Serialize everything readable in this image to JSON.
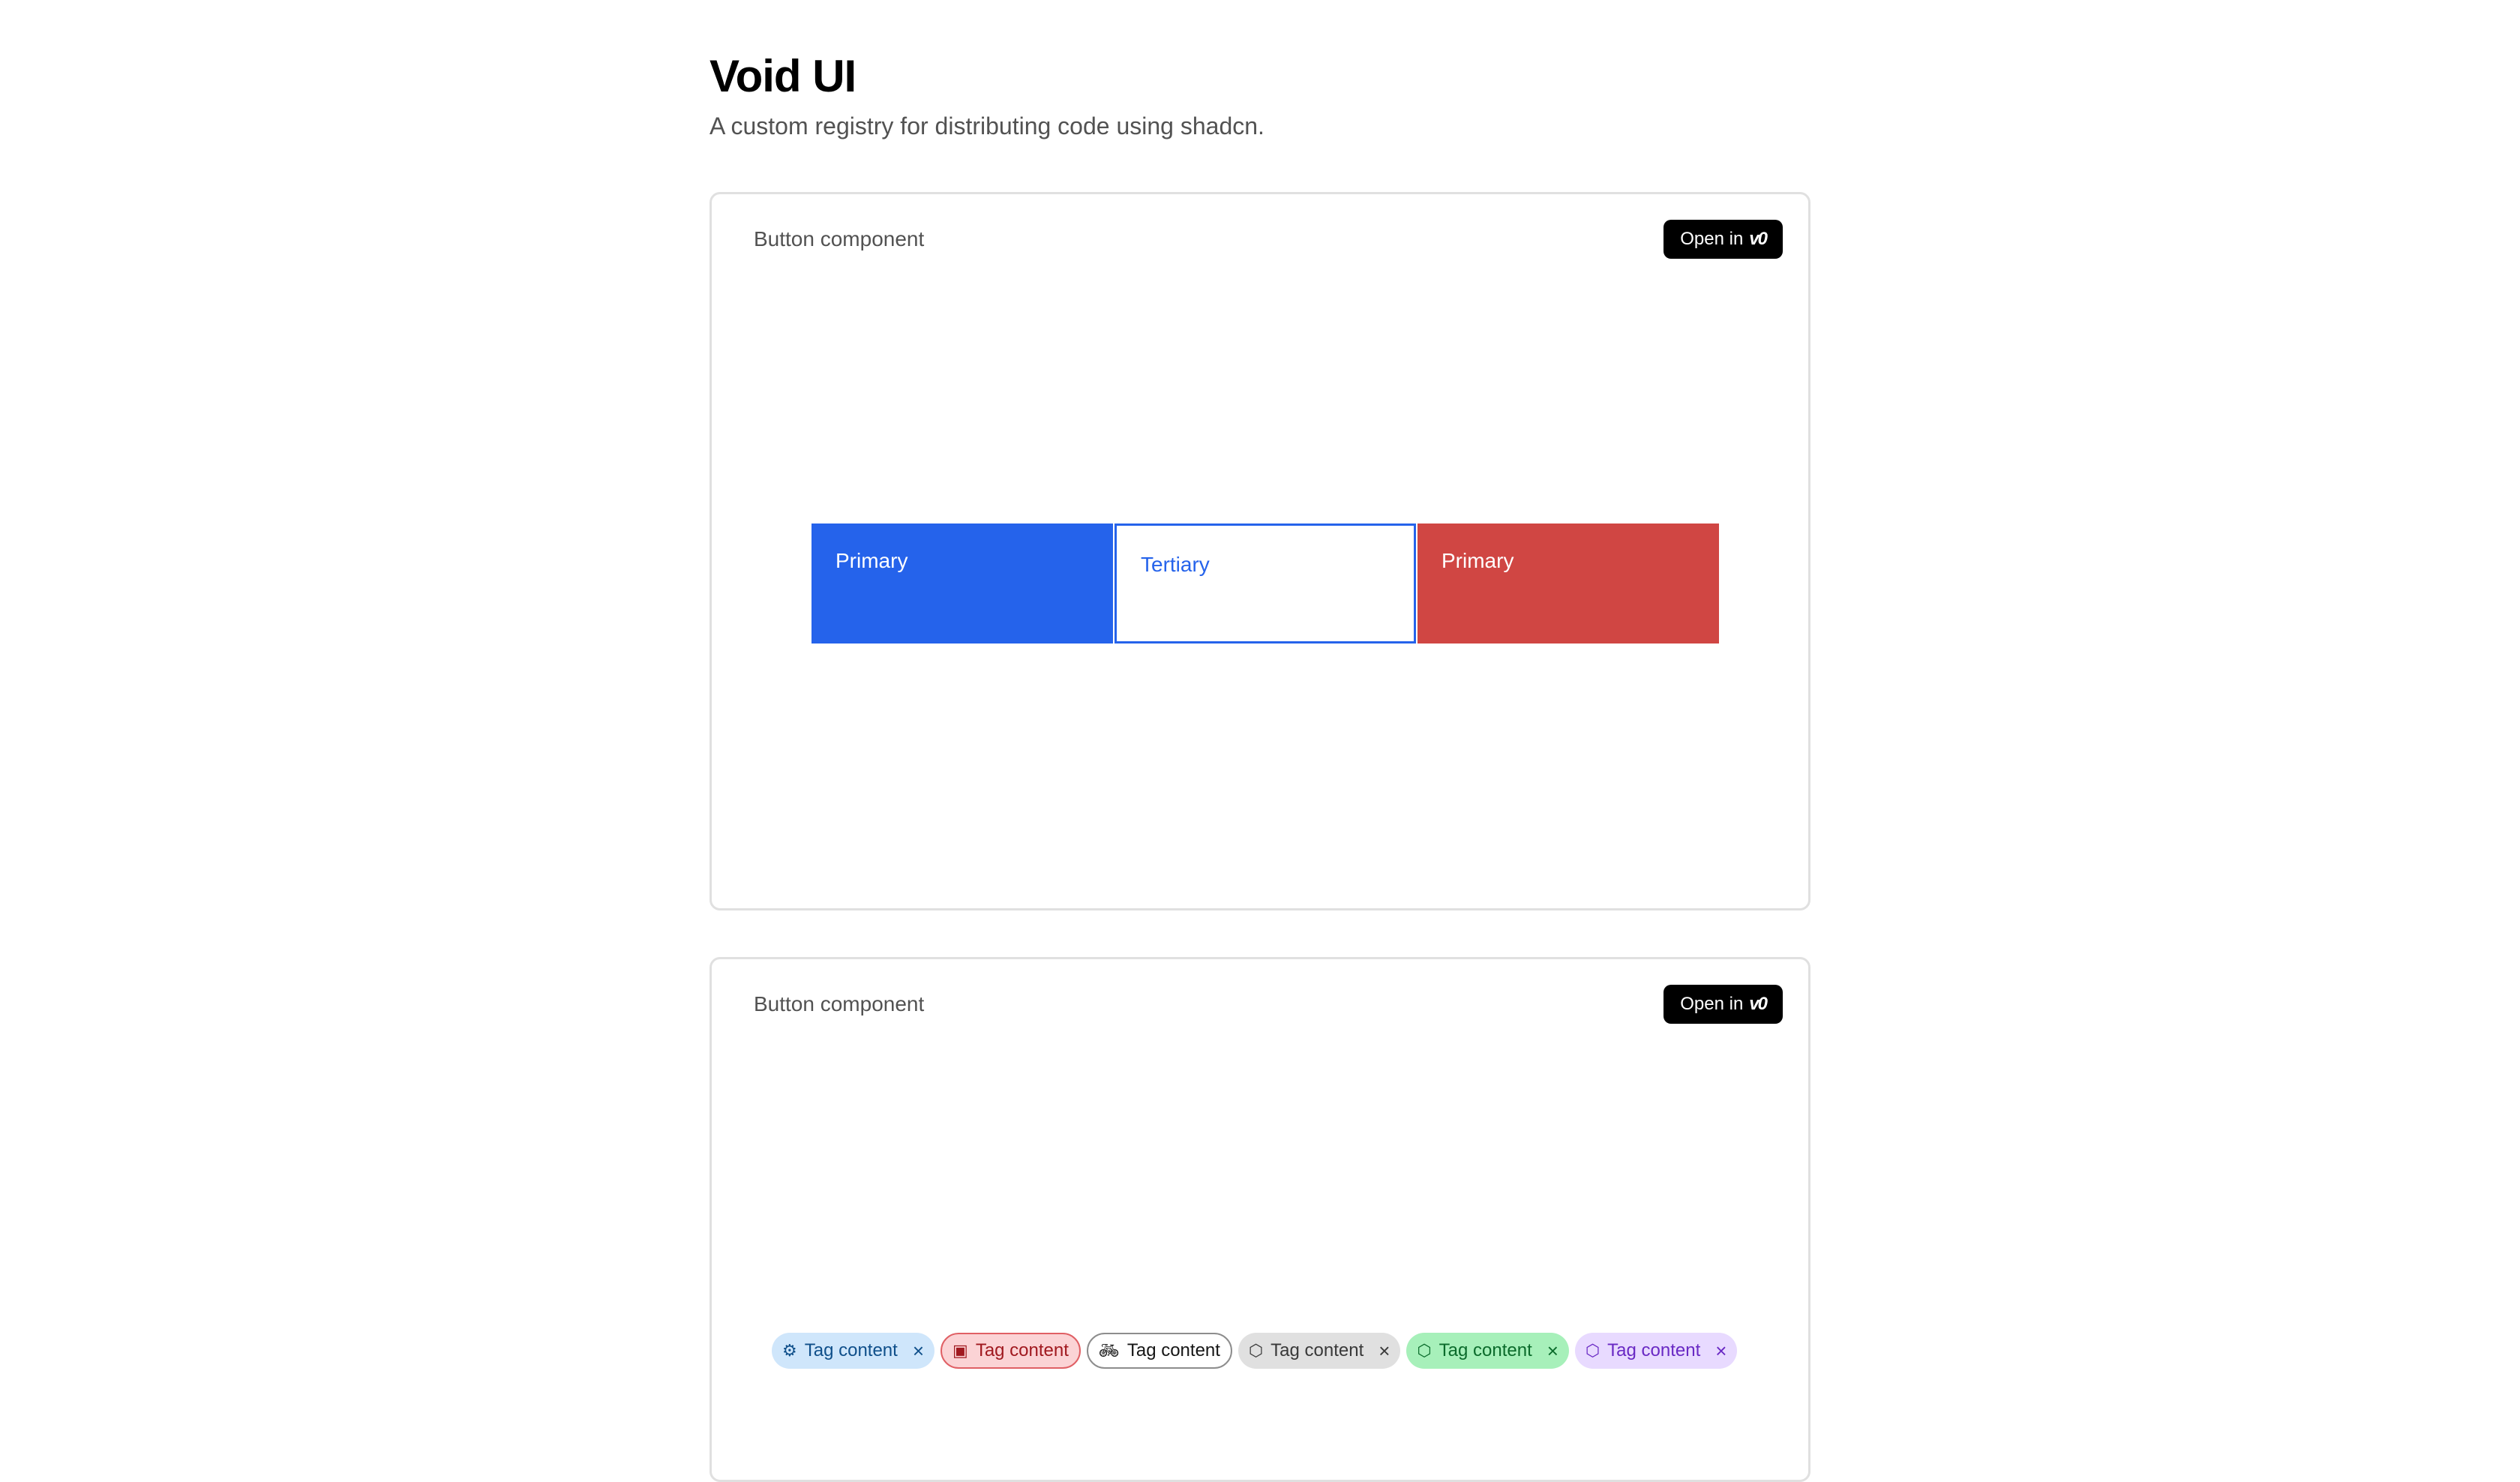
{
  "header": {
    "title": "Void UI",
    "subtitle": "A custom registry for distributing code using shadcn."
  },
  "cards": [
    {
      "title": "Button component",
      "open_label": "Open in",
      "open_icon": "v0",
      "buttons": [
        {
          "label": "Primary",
          "variant": "primary",
          "color": "#2563eb"
        },
        {
          "label": "Tertiary",
          "variant": "tertiary",
          "color": "#2563eb"
        },
        {
          "label": "Primary",
          "variant": "danger",
          "color": "#d04643"
        }
      ]
    },
    {
      "title": "Button component",
      "open_label": "Open in",
      "open_icon": "v0",
      "tags": [
        {
          "label": "Tag content",
          "icon": "gear-icon",
          "color": "blue",
          "dismissible": true
        },
        {
          "label": "Tag content",
          "icon": "square-icon",
          "color": "red",
          "dismissible": false
        },
        {
          "label": "Tag content",
          "icon": "bicycle-icon",
          "color": "outline",
          "dismissible": false
        },
        {
          "label": "Tag content",
          "icon": "hexagon-icon",
          "color": "gray",
          "dismissible": true
        },
        {
          "label": "Tag content",
          "icon": "hexagon-icon",
          "color": "green",
          "dismissible": true
        },
        {
          "label": "Tag content",
          "icon": "hexagon-icon",
          "color": "purple",
          "dismissible": true
        }
      ]
    }
  ]
}
